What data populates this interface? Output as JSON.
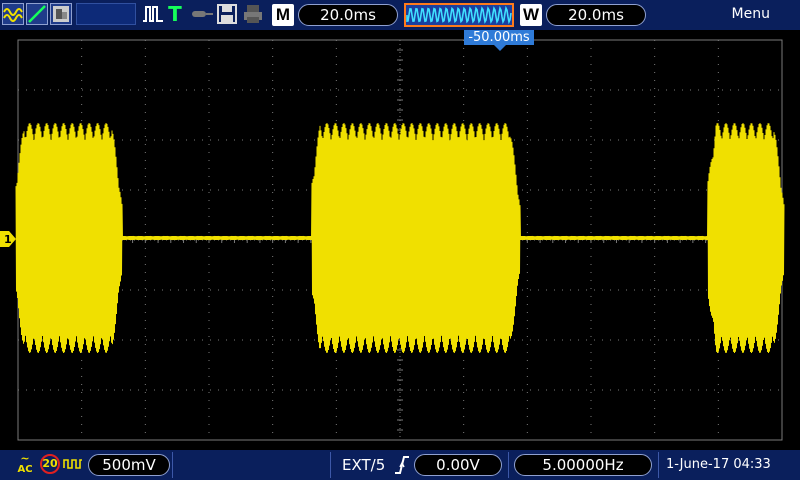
{
  "colors": {
    "channel1": "#f0e000",
    "trigger_level": "#2f7bd8",
    "background": "#000000",
    "bar": "#0a1f5c",
    "grid": "#7a7a7a"
  },
  "top_bar": {
    "icons": [
      "waveform-icon",
      "ramp-icon",
      "image-icon",
      "pulse-icon",
      "trigger-t-icon",
      "probe-icon",
      "save-icon",
      "print-icon"
    ],
    "trigger_status_letter": "T",
    "main_badge": "M",
    "main_timebase": "20.0ms",
    "window_badge": "W",
    "window_timebase": "20.0ms",
    "menu_label": "Menu"
  },
  "trigger_position": "-50.00ms",
  "channel1": {
    "marker_label": "1",
    "coupling": "AC",
    "bandwidth_limit": "20",
    "scale": "500mV"
  },
  "bottom_bar": {
    "trigger_source": "EXT/5",
    "trigger_level": "0.00V",
    "frequency": "5.00000Hz",
    "datetime": "1-June-17 04:33"
  }
}
